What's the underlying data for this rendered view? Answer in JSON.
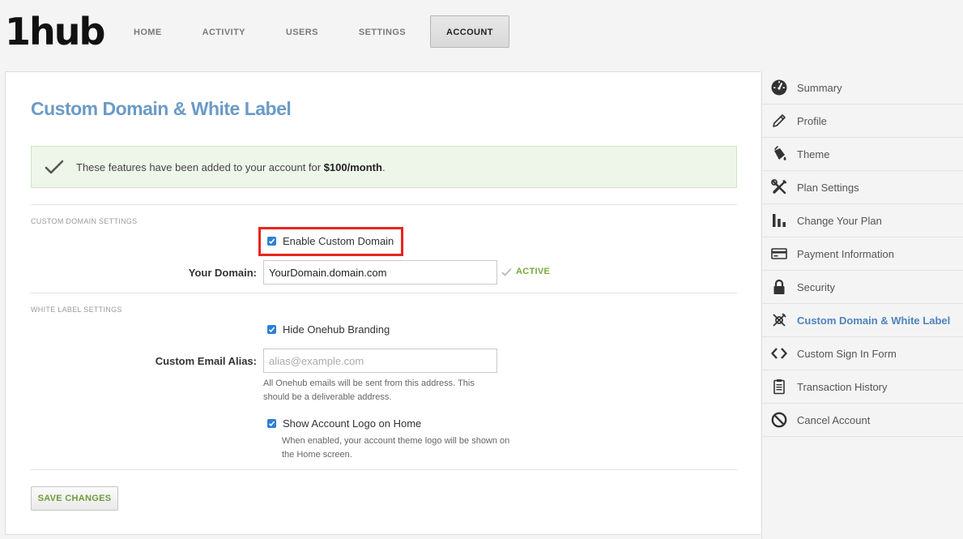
{
  "brand": {
    "logo_text": "1hub"
  },
  "nav": {
    "items": [
      {
        "label": "HOME"
      },
      {
        "label": "ACTIVITY"
      },
      {
        "label": "USERS"
      },
      {
        "label": "SETTINGS"
      },
      {
        "label": "ACCOUNT",
        "active": true
      }
    ]
  },
  "page": {
    "title": "Custom Domain & White Label"
  },
  "notice": {
    "prefix": "These features have been added to your account for ",
    "price": "$100/month",
    "suffix": "."
  },
  "custom_domain": {
    "section_label": "CUSTOM DOMAIN SETTINGS",
    "enable_label": "Enable Custom Domain",
    "enable_checked": true,
    "domain_label": "Your Domain:",
    "domain_value": "YourDomain.domain.com",
    "status": "ACTIVE"
  },
  "white_label": {
    "section_label": "WHITE LABEL SETTINGS",
    "hide_branding_label": "Hide Onehub Branding",
    "hide_branding_checked": true,
    "email_alias_label": "Custom Email Alias:",
    "email_alias_value": "",
    "email_alias_placeholder": "alias@example.com",
    "email_help_line1": "All Onehub emails will be sent from this address. This",
    "email_help_line2": "should be a deliverable address.",
    "show_logo_label": "Show Account Logo on Home",
    "show_logo_checked": true,
    "show_logo_help_line1": "When enabled, your account theme logo will be shown on",
    "show_logo_help_line2": "the Home screen."
  },
  "actions": {
    "save_label": "SAVE CHANGES"
  },
  "sidebar": {
    "items": [
      {
        "label": "Summary",
        "icon": "gauge-icon"
      },
      {
        "label": "Profile",
        "icon": "pencil-icon"
      },
      {
        "label": "Theme",
        "icon": "paint-bucket-icon"
      },
      {
        "label": "Plan Settings",
        "icon": "tools-icon"
      },
      {
        "label": "Change Your Plan",
        "icon": "bar-chart-icon"
      },
      {
        "label": "Payment Information",
        "icon": "credit-card-icon"
      },
      {
        "label": "Security",
        "icon": "lock-icon"
      },
      {
        "label": "Custom Domain & White Label",
        "icon": "satellite-icon",
        "active": true
      },
      {
        "label": "Custom Sign In Form",
        "icon": "code-icon"
      },
      {
        "label": "Transaction History",
        "icon": "receipt-icon"
      },
      {
        "label": "Cancel Account",
        "icon": "ban-icon"
      }
    ]
  },
  "colors": {
    "title": "#6b9ac7",
    "accent_green": "#76a83b",
    "highlight": "#e8261b",
    "checkbox": "#2d7fd8",
    "sidebar_active": "#4d83bd"
  }
}
